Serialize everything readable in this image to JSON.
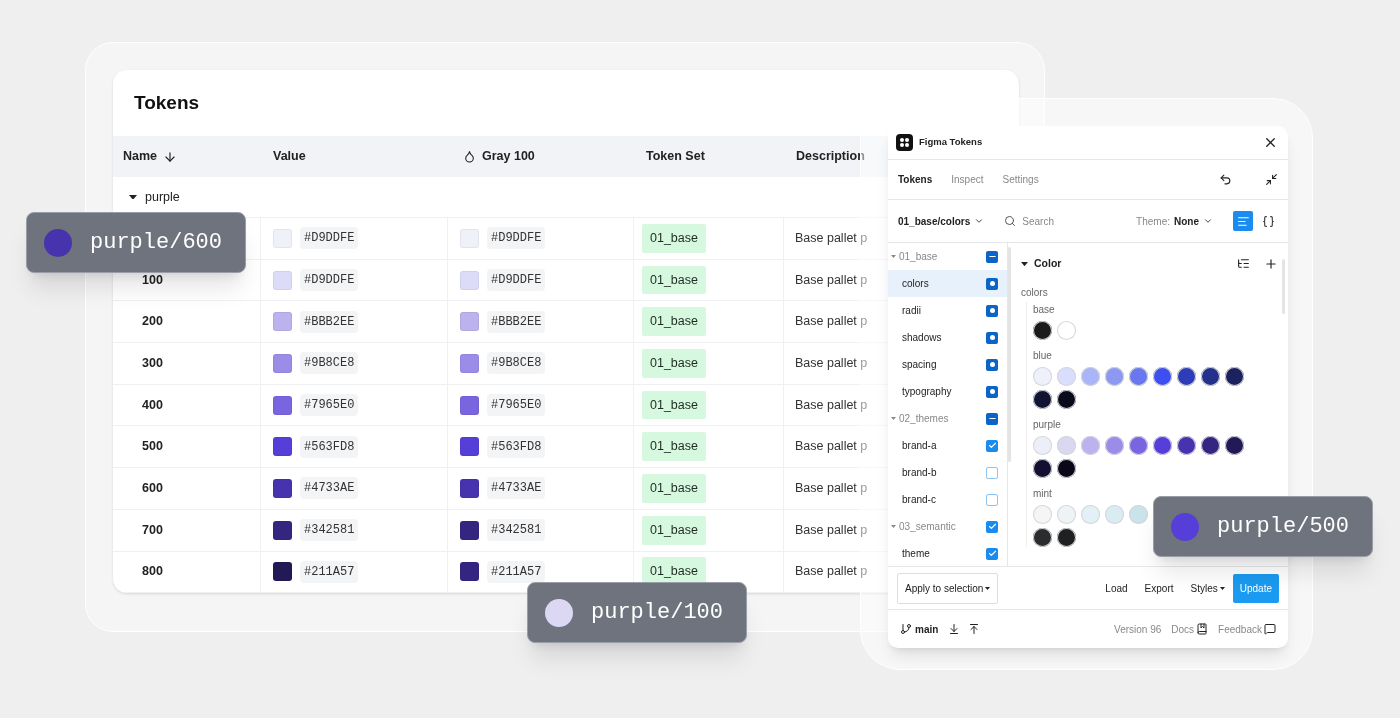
{
  "table": {
    "title": "Tokens",
    "columns": [
      {
        "label": "Name"
      },
      {
        "label": "Value"
      },
      {
        "label": "Gray 100"
      },
      {
        "label": "Token Set"
      },
      {
        "label": "Description"
      }
    ],
    "group": "purple",
    "rows": [
      {
        "value": {
          "color": "#eef2f8",
          "hex": "#D9DDFE"
        },
        "gray": {
          "color": "#eef2f8",
          "hex": "#D9DDFE"
        },
        "token_set": "01_base",
        "description": "Base pallet p"
      },
      {
        "name": "100",
        "value": {
          "color": "#dcdcf8",
          "hex": "#D9DDFE"
        },
        "gray": {
          "color": "#dcdcf8",
          "hex": "#D9DDFE"
        },
        "token_set": "01_base",
        "description": "Base pallet p"
      },
      {
        "name": "200",
        "value": {
          "color": "#bbb2ee",
          "hex": "#BBB2EE"
        },
        "gray": {
          "color": "#bbb2ee",
          "hex": "#BBB2EE"
        },
        "token_set": "01_base",
        "description": "Base pallet p"
      },
      {
        "name": "300",
        "value": {
          "color": "#9b8ce8",
          "hex": "#9B8CE8"
        },
        "gray": {
          "color": "#9b8ce8",
          "hex": "#9B8CE8"
        },
        "token_set": "01_base",
        "description": "Base pallet p"
      },
      {
        "name": "400",
        "value": {
          "color": "#7965e0",
          "hex": "#7965E0"
        },
        "gray": {
          "color": "#7965e0",
          "hex": "#7965E0"
        },
        "token_set": "01_base",
        "description": "Base pallet p"
      },
      {
        "name": "500",
        "value": {
          "color": "#563fd8",
          "hex": "#563FD8"
        },
        "gray": {
          "color": "#563fd8",
          "hex": "#563FD8"
        },
        "token_set": "01_base",
        "description": "Base pallet p"
      },
      {
        "name": "600",
        "value": {
          "color": "#4733ae",
          "hex": "#4733AE"
        },
        "gray": {
          "color": "#4733ae",
          "hex": "#4733AE"
        },
        "token_set": "01_base",
        "description": "Base pallet p"
      },
      {
        "name": "700",
        "value": {
          "color": "#342581",
          "hex": "#342581"
        },
        "gray": {
          "color": "#342581",
          "hex": "#342581"
        },
        "token_set": "01_base",
        "description": "Base pallet p"
      },
      {
        "name": "800",
        "value": {
          "color": "#211a57",
          "hex": "#211A57"
        },
        "gray": {
          "color": "#342581",
          "hex": "#211A57"
        },
        "token_set": "01_base",
        "description": "Base pallet p"
      }
    ]
  },
  "plugin": {
    "title": "Figma Tokens",
    "tabs": [
      {
        "label": "Tokens",
        "selected": true
      },
      {
        "label": "Inspect",
        "selected": false
      },
      {
        "label": "Settings",
        "selected": false
      }
    ],
    "token_set": "01_base/colors",
    "search": {
      "placeholder": "Search"
    },
    "theme_label": "Theme:",
    "theme_value": "None",
    "views": [
      {
        "kind": "list",
        "selected": true
      },
      {
        "kind": "json",
        "selected": false
      }
    ],
    "sets": [
      {
        "label": "01_base",
        "kind": "partial",
        "checked": true,
        "expanded": true,
        "selected": false,
        "children": [
          {
            "label": "colors",
            "kind": "source",
            "checked": true,
            "selected": true
          },
          {
            "label": "radii",
            "kind": "source",
            "checked": true,
            "selected": false
          },
          {
            "label": "shadows",
            "kind": "source",
            "checked": true,
            "selected": false
          },
          {
            "label": "spacing",
            "kind": "source",
            "checked": true,
            "selected": false
          },
          {
            "label": "typography",
            "kind": "source",
            "checked": true,
            "selected": false
          }
        ]
      },
      {
        "label": "02_themes",
        "kind": "partial",
        "checked": true,
        "expanded": true,
        "selected": false,
        "children": [
          {
            "label": "brand-a",
            "kind": "tick",
            "checked": true,
            "selected": false
          },
          {
            "label": "brand-b",
            "checked": false,
            "selected": false
          },
          {
            "label": "brand-c",
            "checked": false,
            "selected": false
          }
        ]
      },
      {
        "label": "03_semantic",
        "kind": "tick",
        "checked": true,
        "expanded": true,
        "selected": false,
        "children": [
          {
            "label": "theme",
            "kind": "tick",
            "checked": true,
            "selected": false
          }
        ]
      }
    ],
    "section": "Color",
    "subsection": "colors",
    "groups": [
      {
        "label": "base",
        "rows": [
          [
            {
              "color": "#1a1a1a"
            },
            {
              "color": "#ffffff"
            }
          ]
        ]
      },
      {
        "label": "blue",
        "rows": [
          [
            {
              "color": "#eef0fa"
            },
            {
              "color": "#d9ddfe"
            },
            {
              "color": "#aab4f8"
            },
            {
              "color": "#8c98f2"
            },
            {
              "color": "#6978f0"
            },
            {
              "color": "#3d4ff0"
            },
            {
              "color": "#2d3cb8"
            },
            {
              "color": "#23308c"
            },
            {
              "color": "#1c2260"
            }
          ],
          [
            {
              "color": "#111433"
            },
            {
              "color": "#0a0b1a"
            }
          ]
        ]
      },
      {
        "label": "purple",
        "rows": [
          [
            {
              "color": "#eceef8"
            },
            {
              "color": "#d9d8f0"
            },
            {
              "color": "#bbb2ee"
            },
            {
              "color": "#9b8ce8"
            },
            {
              "color": "#7965e0"
            },
            {
              "color": "#563fd8"
            },
            {
              "color": "#4733ae"
            },
            {
              "color": "#342581"
            },
            {
              "color": "#211a57"
            }
          ],
          [
            {
              "color": "#120f33"
            },
            {
              "color": "#0a0818"
            }
          ]
        ]
      },
      {
        "label": "mint",
        "rows": [
          [
            {
              "color": "#f5f5f5"
            },
            {
              "color": "#eef3f5"
            },
            {
              "color": "#e3f0f5"
            },
            {
              "color": "#d8ecf2"
            },
            {
              "color": "#c8e3ea"
            }
          ],
          [
            {
              "color": "#2a2c2e"
            },
            {
              "color": "#1f2022"
            }
          ]
        ]
      }
    ],
    "apply": "Apply to selection",
    "actions": [
      "Load",
      "Export"
    ],
    "styles": "Styles",
    "update": "Update",
    "branch": "main",
    "version": "Version 96",
    "docs": "Docs",
    "feedback": "Feedback"
  },
  "chips": [
    {
      "label": "purple/600",
      "color": "#4733ae"
    },
    {
      "label": "purple/100",
      "color": "#dcd8f4"
    },
    {
      "label": "purple/500",
      "color": "#563fd8"
    }
  ]
}
